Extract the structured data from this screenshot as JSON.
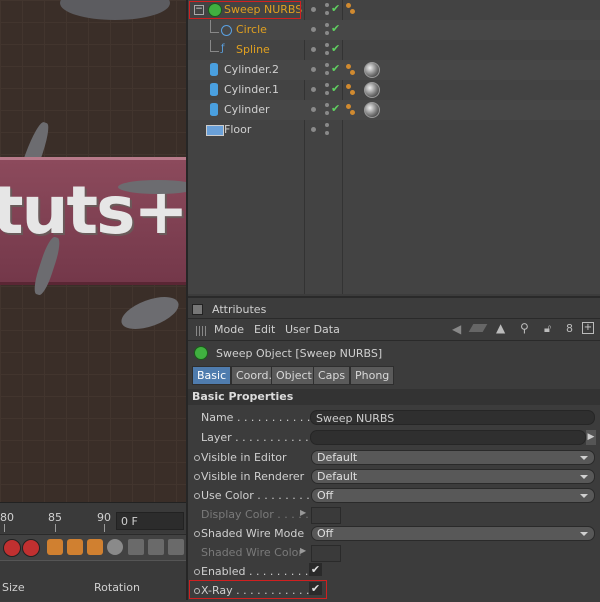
{
  "viewport": {
    "banner_text": "tuts+"
  },
  "timeline": {
    "ticks": [
      "80",
      "85",
      "90"
    ],
    "frame": "0 F"
  },
  "coords": {
    "size_label": "Size",
    "rotation_label": "Rotation"
  },
  "objects": [
    {
      "name": "Sweep NURBS",
      "icon": "sweep-nurbs-icon"
    },
    {
      "name": "Circle",
      "icon": "circle-spline-icon"
    },
    {
      "name": "Spline",
      "icon": "spline-icon"
    },
    {
      "name": "Cylinder.2",
      "icon": "cylinder-icon"
    },
    {
      "name": "Cylinder.1",
      "icon": "cylinder-icon"
    },
    {
      "name": "Cylinder",
      "icon": "cylinder-icon"
    },
    {
      "name": "Floor",
      "icon": "floor-icon"
    }
  ],
  "attributes": {
    "title": "Attributes",
    "menu": [
      "Mode",
      "Edit",
      "User Data"
    ],
    "object_title": "Sweep Object [Sweep NURBS]",
    "tabs": [
      "Basic",
      "Coord.",
      "Object",
      "Caps",
      "Phong"
    ],
    "section": "Basic Properties",
    "props": {
      "name_label": "Name . . . . . . . . . . .",
      "name_value": "Sweep NURBS",
      "layer_label": "Layer . . . . . . . . . . .",
      "vis_editor_label": "Visible in Editor",
      "vis_editor_value": "Default",
      "vis_renderer_label": "Visible in Renderer",
      "vis_renderer_value": "Default",
      "use_color_label": "Use Color . . . . . . . . .",
      "use_color_value": "Off",
      "display_color_label": "Display Color . . . . . . .",
      "shaded_wire_mode_label": "Shaded Wire Mode",
      "shaded_wire_mode_value": "Off",
      "shaded_wire_color_label": "Shaded Wire Color",
      "enabled_label": "Enabled . . . . . . . . . .",
      "xray_label": "X-Ray . . . . . . . . . . ."
    }
  },
  "colors": {
    "accent": "#4f7cae",
    "highlight": "#d02020",
    "orange_text": "#e0a020"
  }
}
